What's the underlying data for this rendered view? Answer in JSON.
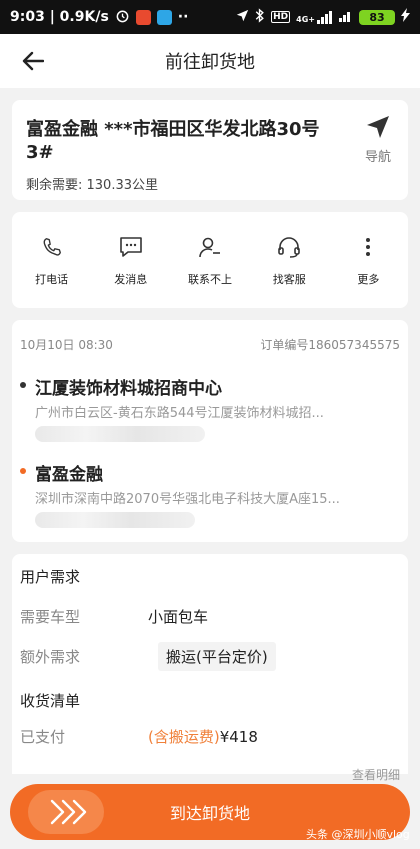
{
  "status_bar": {
    "time_speed": "9:03 | 0.9K/s",
    "network": "4G+",
    "battery": "83"
  },
  "header": {
    "title": "前往卸货地"
  },
  "destination": {
    "name": "富盈金融 ***市福田区华发北路30号3#",
    "remaining": "剩余需要: 130.33公里",
    "nav_label": "导航"
  },
  "actions": [
    {
      "label": "打电话",
      "icon": "phone-icon"
    },
    {
      "label": "发消息",
      "icon": "message-icon"
    },
    {
      "label": "联系不上",
      "icon": "contact-unreachable-icon"
    },
    {
      "label": "找客服",
      "icon": "headset-icon"
    },
    {
      "label": "更多",
      "icon": "more-icon"
    }
  ],
  "order": {
    "time": "10月10日 08:30",
    "order_no": "订单编号186057345575",
    "pickup": {
      "name": "江厦装饰材料城招商中心",
      "address": "广州市白云区-黄石东路544号江厦装饰材料城招...",
      "dot_color": "#333333"
    },
    "dropoff": {
      "name": "富盈金融",
      "address": "深圳市深南中路2070号华强北电子科技大厦A座15...",
      "dot_color": "#f26b25"
    }
  },
  "requirements": {
    "section_title": "用户需求",
    "vehicle_key": "需要车型",
    "vehicle_value": "小面包车",
    "extra_key": "额外需求",
    "extra_value": "搬运(平台定价)",
    "list_title": "收货清单",
    "paid_key": "已支付",
    "paid_note": "(含搬运费)",
    "paid_amount": "¥418",
    "view_detail": "查看明细"
  },
  "cta": {
    "label": "到达卸货地"
  },
  "watermark": "头条 @深圳小顺vlog",
  "colors": {
    "accent": "#f26b25",
    "status_bar": "#111111",
    "battery": "#7ed321"
  }
}
